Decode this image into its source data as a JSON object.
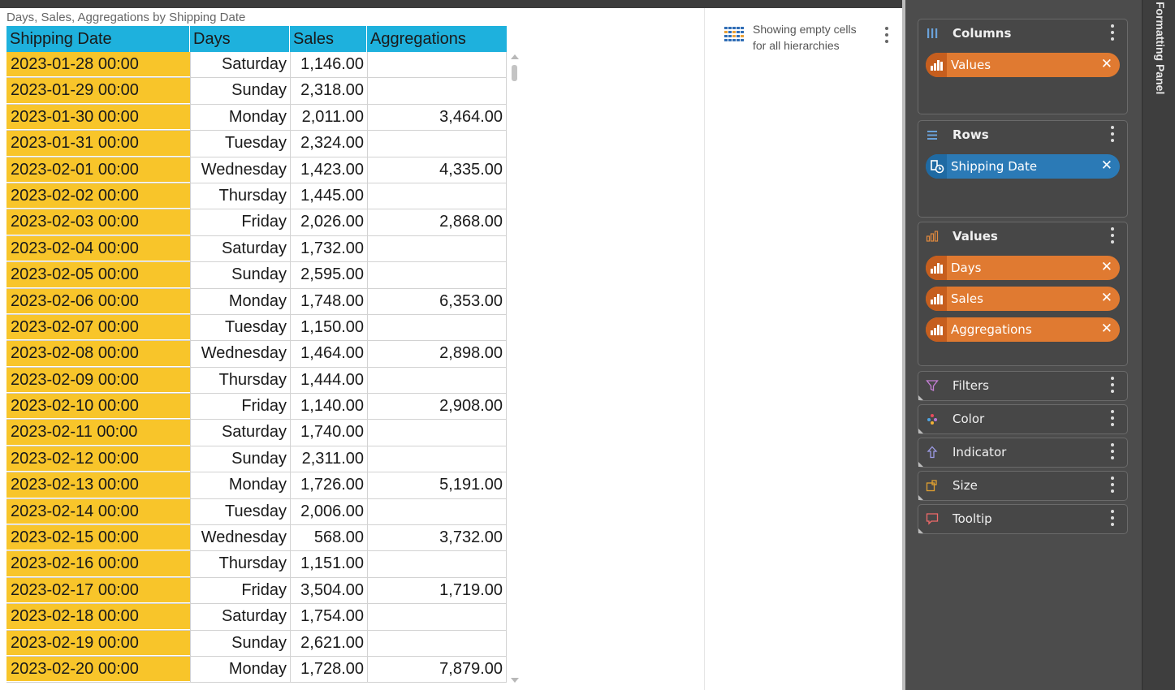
{
  "chart": {
    "title": "Days, Sales, Aggregations by Shipping Date",
    "headers": [
      "Shipping Date",
      "Days",
      "Sales",
      "Aggregations"
    ],
    "rows": [
      {
        "date": "2023-01-28 00:00",
        "day": "Saturday",
        "sales": "1,146.00",
        "agg": ""
      },
      {
        "date": "2023-01-29 00:00",
        "day": "Sunday",
        "sales": "2,318.00",
        "agg": ""
      },
      {
        "date": "2023-01-30 00:00",
        "day": "Monday",
        "sales": "2,011.00",
        "agg": "3,464.00"
      },
      {
        "date": "2023-01-31 00:00",
        "day": "Tuesday",
        "sales": "2,324.00",
        "agg": ""
      },
      {
        "date": "2023-02-01 00:00",
        "day": "Wednesday",
        "sales": "1,423.00",
        "agg": "4,335.00"
      },
      {
        "date": "2023-02-02 00:00",
        "day": "Thursday",
        "sales": "1,445.00",
        "agg": ""
      },
      {
        "date": "2023-02-03 00:00",
        "day": "Friday",
        "sales": "2,026.00",
        "agg": "2,868.00"
      },
      {
        "date": "2023-02-04 00:00",
        "day": "Saturday",
        "sales": "1,732.00",
        "agg": ""
      },
      {
        "date": "2023-02-05 00:00",
        "day": "Sunday",
        "sales": "2,595.00",
        "agg": ""
      },
      {
        "date": "2023-02-06 00:00",
        "day": "Monday",
        "sales": "1,748.00",
        "agg": "6,353.00"
      },
      {
        "date": "2023-02-07 00:00",
        "day": "Tuesday",
        "sales": "1,150.00",
        "agg": ""
      },
      {
        "date": "2023-02-08 00:00",
        "day": "Wednesday",
        "sales": "1,464.00",
        "agg": "2,898.00"
      },
      {
        "date": "2023-02-09 00:00",
        "day": "Thursday",
        "sales": "1,444.00",
        "agg": ""
      },
      {
        "date": "2023-02-10 00:00",
        "day": "Friday",
        "sales": "1,140.00",
        "agg": "2,908.00"
      },
      {
        "date": "2023-02-11 00:00",
        "day": "Saturday",
        "sales": "1,740.00",
        "agg": ""
      },
      {
        "date": "2023-02-12 00:00",
        "day": "Sunday",
        "sales": "2,311.00",
        "agg": ""
      },
      {
        "date": "2023-02-13 00:00",
        "day": "Monday",
        "sales": "1,726.00",
        "agg": "5,191.00"
      },
      {
        "date": "2023-02-14 00:00",
        "day": "Tuesday",
        "sales": "2,006.00",
        "agg": ""
      },
      {
        "date": "2023-02-15 00:00",
        "day": "Wednesday",
        "sales": "568.00",
        "agg": "3,732.00"
      },
      {
        "date": "2023-02-16 00:00",
        "day": "Thursday",
        "sales": "1,151.00",
        "agg": ""
      },
      {
        "date": "2023-02-17 00:00",
        "day": "Friday",
        "sales": "3,504.00",
        "agg": "1,719.00"
      },
      {
        "date": "2023-02-18 00:00",
        "day": "Saturday",
        "sales": "1,754.00",
        "agg": ""
      },
      {
        "date": "2023-02-19 00:00",
        "day": "Sunday",
        "sales": "2,621.00",
        "agg": ""
      },
      {
        "date": "2023-02-20 00:00",
        "day": "Monday",
        "sales": "1,728.00",
        "agg": "7,879.00"
      }
    ]
  },
  "empty_cells_note": {
    "line1": "Showing empty cells",
    "line2": "for all hierarchies"
  },
  "panel": {
    "side_label": "Formatting Panel",
    "columns": {
      "title": "Columns",
      "chips": [
        "Values"
      ]
    },
    "rows": {
      "title": "Rows",
      "chips": [
        "Shipping Date"
      ]
    },
    "values": {
      "title": "Values",
      "chips": [
        "Days",
        "Sales",
        "Aggregations"
      ]
    },
    "filters": {
      "title": "Filters"
    },
    "color": {
      "title": "Color"
    },
    "indicator": {
      "title": "Indicator"
    },
    "size": {
      "title": "Size"
    },
    "tooltip": {
      "title": "Tooltip"
    }
  },
  "colors": {
    "header": "#1eb1dd",
    "row_header": "#f8c52a",
    "panel_bg": "#4c4c4c",
    "chip_orange": "#e07a31",
    "chip_blue": "#2b7ab6"
  },
  "icons": {
    "empty_cells": "grid-icon",
    "columns": "columns-icon",
    "rows": "rows-icon",
    "values": "values-icon",
    "filters": "filter-icon",
    "color": "color-dots-icon",
    "indicator": "arrow-up-icon",
    "size": "size-icon",
    "tooltip": "tooltip-icon"
  }
}
